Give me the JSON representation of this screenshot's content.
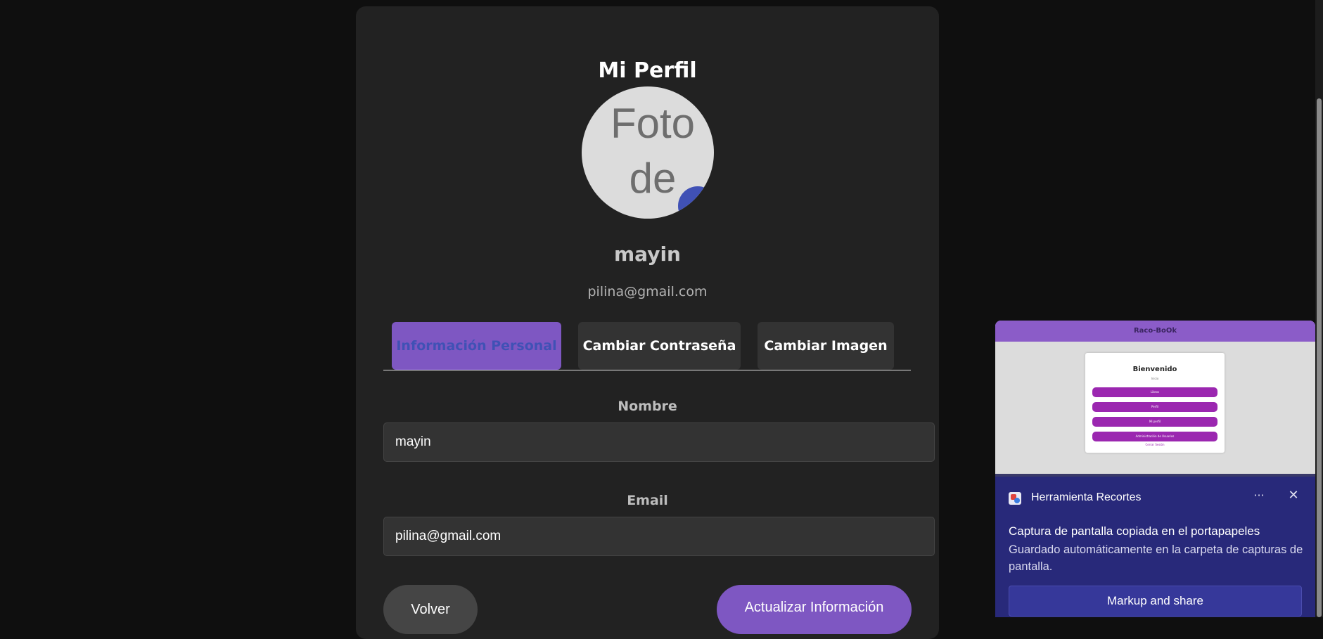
{
  "profile": {
    "title": "Mi Perfil",
    "avatar_placeholder_line1": "Foto",
    "avatar_placeholder_line2": "de",
    "username": "mayin",
    "email": "pilina@gmail.com"
  },
  "tabs": [
    {
      "label": "Información Personal",
      "active": true
    },
    {
      "label": "Cambiar Contraseña",
      "active": false
    },
    {
      "label": "Cambiar Imagen",
      "active": false
    }
  ],
  "form": {
    "name_label": "Nombre",
    "name_value": "mayin",
    "email_label": "Email",
    "email_value": "pilina@gmail.com"
  },
  "buttons": {
    "back": "Volver",
    "update": "Actualizar Información"
  },
  "notification": {
    "app_name": "Herramienta Recortes",
    "more": "···",
    "close": "✕",
    "title": "Captura de pantalla copiada en el portapapeles",
    "body": "Guardado automáticamente en la carpeta de capturas de pantalla.",
    "action": "Markup and share",
    "preview": {
      "app_bar": "Raco-BoOk",
      "heading": "Bienvenido",
      "subtitle": "Inicio",
      "buttons": [
        "Libros",
        "Perfil",
        "Mi perfil",
        "Administración de Usuarios"
      ],
      "link": "Cerrar Sesión"
    }
  },
  "colors": {
    "background": "#0f0f0f",
    "card": "#222222",
    "accent": "#7e57c2",
    "active_tab_text": "#4051b5",
    "notification_bg": "#28297a"
  }
}
